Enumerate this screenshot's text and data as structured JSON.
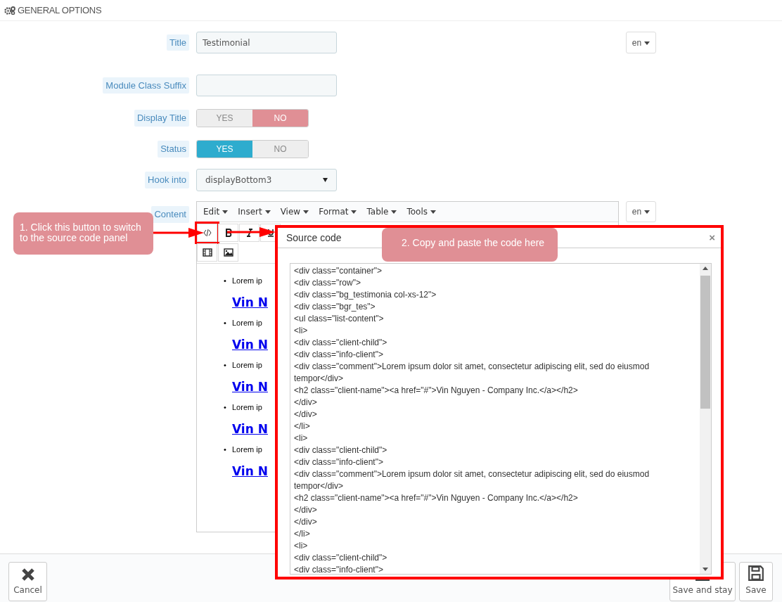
{
  "section": {
    "title": "GENERAL OPTIONS"
  },
  "fields": [
    {
      "kind": "text",
      "label": "Title",
      "value": "Testimonial",
      "language": "en"
    },
    {
      "kind": "text",
      "label": "Module Class Suffix"
    },
    {
      "kind": "switch",
      "label": "Display Title",
      "options": [
        {
          "label": "YES",
          "selected": false
        },
        {
          "label": "NO",
          "selected": true
        }
      ]
    },
    {
      "kind": "switch",
      "label": "Status",
      "options": [
        {
          "label": "YES",
          "selected": true
        },
        {
          "label": "NO",
          "selected": false
        }
      ]
    },
    {
      "kind": "select",
      "label": "Hook into",
      "value": "displayBottom3"
    },
    {
      "kind": "editor",
      "label": "Content",
      "language": "en"
    }
  ],
  "editor": {
    "menus": [
      "Edit",
      "Insert",
      "View",
      "Format",
      "Table",
      "Tools"
    ],
    "items": [
      {
        "marker": "•",
        "text": "Lorem ip",
        "link": "Vin N"
      },
      {
        "marker": "•",
        "text": "Lorem ip",
        "link": "Vin N"
      },
      {
        "marker": "•",
        "text": "Lorem ip",
        "link": "Vin N"
      },
      {
        "marker": "•",
        "text": "Lorem ip",
        "link": "Vin N"
      },
      {
        "marker": "•",
        "text": "Lorem ip",
        "link": "Vin N"
      }
    ]
  },
  "dialog": {
    "title": "Source code",
    "close": "×",
    "code": [
      "<div class=\"container\">",
      "<div class=\"row\">",
      "<div class=\"bg_testimonia col-xs-12\">",
      "<div class=\"bgr_tes\">",
      "<ul class=\"list-content\">",
      "<li>",
      "<div class=\"client-child\">",
      "<div class=\"info-client\">",
      "<div class=\"comment\">Lorem ipsum dolor sit amet, consectetur adipiscing elit, sed do eiusmod tempor</div>",
      "<h2 class=\"client-name\"><a href=\"#\">Vin Nguyen - Company Inc.</a></h2>",
      "</div>",
      "</div>",
      "</li>",
      "<li>",
      "<div class=\"client-child\">",
      "<div class=\"info-client\">",
      "<div class=\"comment\">Lorem ipsum dolor sit amet, consectetur adipiscing elit, sed do eiusmod tempor</div>",
      "<h2 class=\"client-name\"><a href=\"#\">Vin Nguyen - Company Inc.</a></h2>",
      "</div>",
      "</div>",
      "</li>",
      "<li>",
      "<div class=\"client-child\">",
      "<div class=\"info-client\">"
    ]
  },
  "callouts": [
    {
      "text": "1. Click this button to switch to the source code panel"
    },
    {
      "text": "2. Copy and paste the code here"
    }
  ],
  "footer": {
    "buttons": [
      {
        "kind": "cancel",
        "label": "Cancel"
      },
      {
        "kind": "save_stay",
        "label": "Save and stay"
      },
      {
        "kind": "save",
        "label": "Save"
      }
    ]
  }
}
